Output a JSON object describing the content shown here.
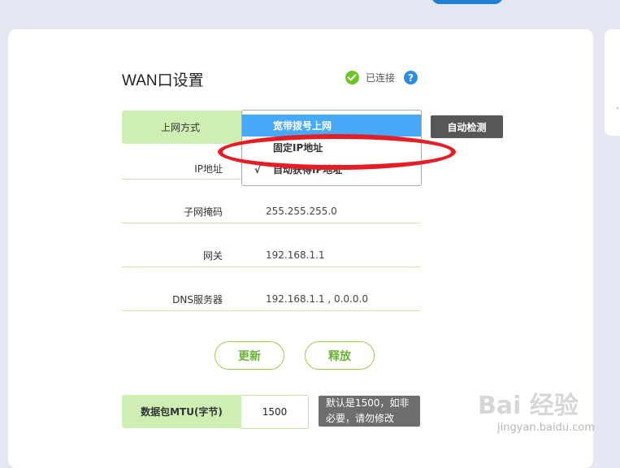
{
  "header": {
    "title": "WAN口设置",
    "status_text": "已连接",
    "help_glyph": "?"
  },
  "connection_type": {
    "label": "上网方式",
    "options": [
      {
        "label": "宽带拨号上网",
        "highlighted": true,
        "checkmark": ""
      },
      {
        "label": "固定IP地址",
        "highlighted": false,
        "checkmark": ""
      },
      {
        "label": "自动获得IP地址",
        "highlighted": false,
        "checkmark": "√"
      }
    ],
    "auto_detect_button": "自动检测"
  },
  "fields": {
    "ip": {
      "label": "IP地址"
    },
    "subnet": {
      "label": "子网掩码",
      "value": "255.255.255.0"
    },
    "gateway": {
      "label": "网关",
      "value": "192.168.1.1"
    },
    "dns": {
      "label": "DNS服务器",
      "value": "192.168.1.1 , 0.0.0.0"
    }
  },
  "buttons": {
    "renew": "更新",
    "release": "释放"
  },
  "mtu": {
    "label": "数据包MTU(字节)",
    "value": "1500",
    "tip_line1": "默认是1500，如非",
    "tip_line2": "必要，请勿修改"
  },
  "watermark": {
    "brand": "Bai 经验",
    "url": "jingyan.baidu.com"
  },
  "colors": {
    "accent_blue": "#48a9f8",
    "label_green": "#cfeeb3",
    "annotation_red": "#e41e26",
    "button_green": "#6ab233",
    "ok_green": "#6cc32a"
  },
  "icons": {
    "status": "check-circle-icon",
    "help": "question-circle-icon"
  }
}
